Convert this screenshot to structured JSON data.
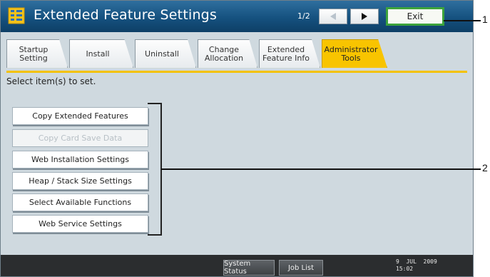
{
  "titlebar": {
    "title": "Extended Feature Settings",
    "page_indicator": "1/2",
    "prev_icon": "triangle-left-icon",
    "next_icon": "triangle-right-icon",
    "exit_label": "Exit",
    "icon": "extended-feature-icon"
  },
  "tabs": [
    {
      "label": "Startup\nSetting",
      "active": false
    },
    {
      "label": "Install",
      "active": false
    },
    {
      "label": "Uninstall",
      "active": false
    },
    {
      "label": "Change\nAllocation",
      "active": false
    },
    {
      "label": "Extended\nFeature Info",
      "active": false
    },
    {
      "label": "Administrator\nTools",
      "active": true
    }
  ],
  "instruction": "Select item(s) to set.",
  "menu": [
    {
      "label": "Copy Extended Features",
      "enabled": true
    },
    {
      "label": "Copy Card Save Data",
      "enabled": false
    },
    {
      "label": "Web Installation Settings",
      "enabled": true
    },
    {
      "label": "Heap / Stack Size Settings",
      "enabled": true
    },
    {
      "label": "Select Available Functions",
      "enabled": true
    },
    {
      "label": "Web Service Settings",
      "enabled": true
    }
  ],
  "bottombar": {
    "system_status_label": "System Status",
    "job_list_label": "Job List",
    "date": "9  JUL  2009",
    "time": "15:02"
  },
  "callouts": {
    "one": "1",
    "two": "2"
  },
  "colors": {
    "titlebar": "#15517f",
    "active_tab": "#f8c400",
    "exit_border": "#3ca33c",
    "screen_bg": "#cfd9df"
  }
}
